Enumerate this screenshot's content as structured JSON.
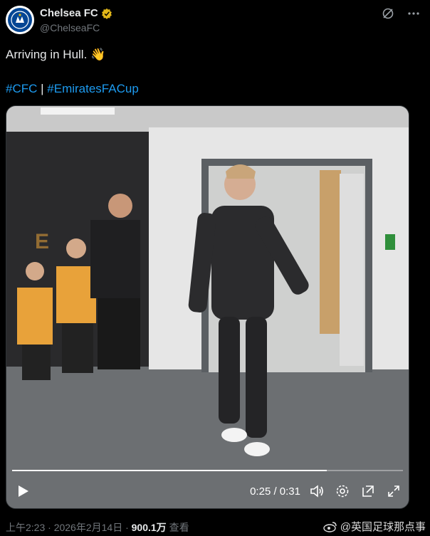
{
  "header": {
    "display_name": "Chelsea FC",
    "handle": "@ChelseaFC",
    "verified_icon": "verified-badge-icon",
    "icons": [
      "grok-icon",
      "more-options-icon"
    ]
  },
  "tweet": {
    "text": "Arriving in Hull. 👋",
    "hashtag1": "#CFC",
    "separator": " | ",
    "hashtag2": "#EmiratesFACup"
  },
  "video": {
    "time": "0:25 / 0:31",
    "progress": 0.806,
    "controls": [
      "play-icon",
      "volume-icon",
      "settings-icon",
      "pip-icon",
      "fullscreen-icon"
    ]
  },
  "footer": {
    "time_date": "上午2:23 · 2026年2月14日 · ",
    "views_count": "900.1万",
    "views_label": " 查看"
  },
  "watermark": {
    "text": "@英国足球那点事",
    "icon": "weibo-icon"
  },
  "colors": {
    "background": "#000000",
    "link": "#1d9bf0",
    "muted": "#71767b",
    "chelsea_blue": "#034694",
    "verified_gold": "#e2b719"
  }
}
